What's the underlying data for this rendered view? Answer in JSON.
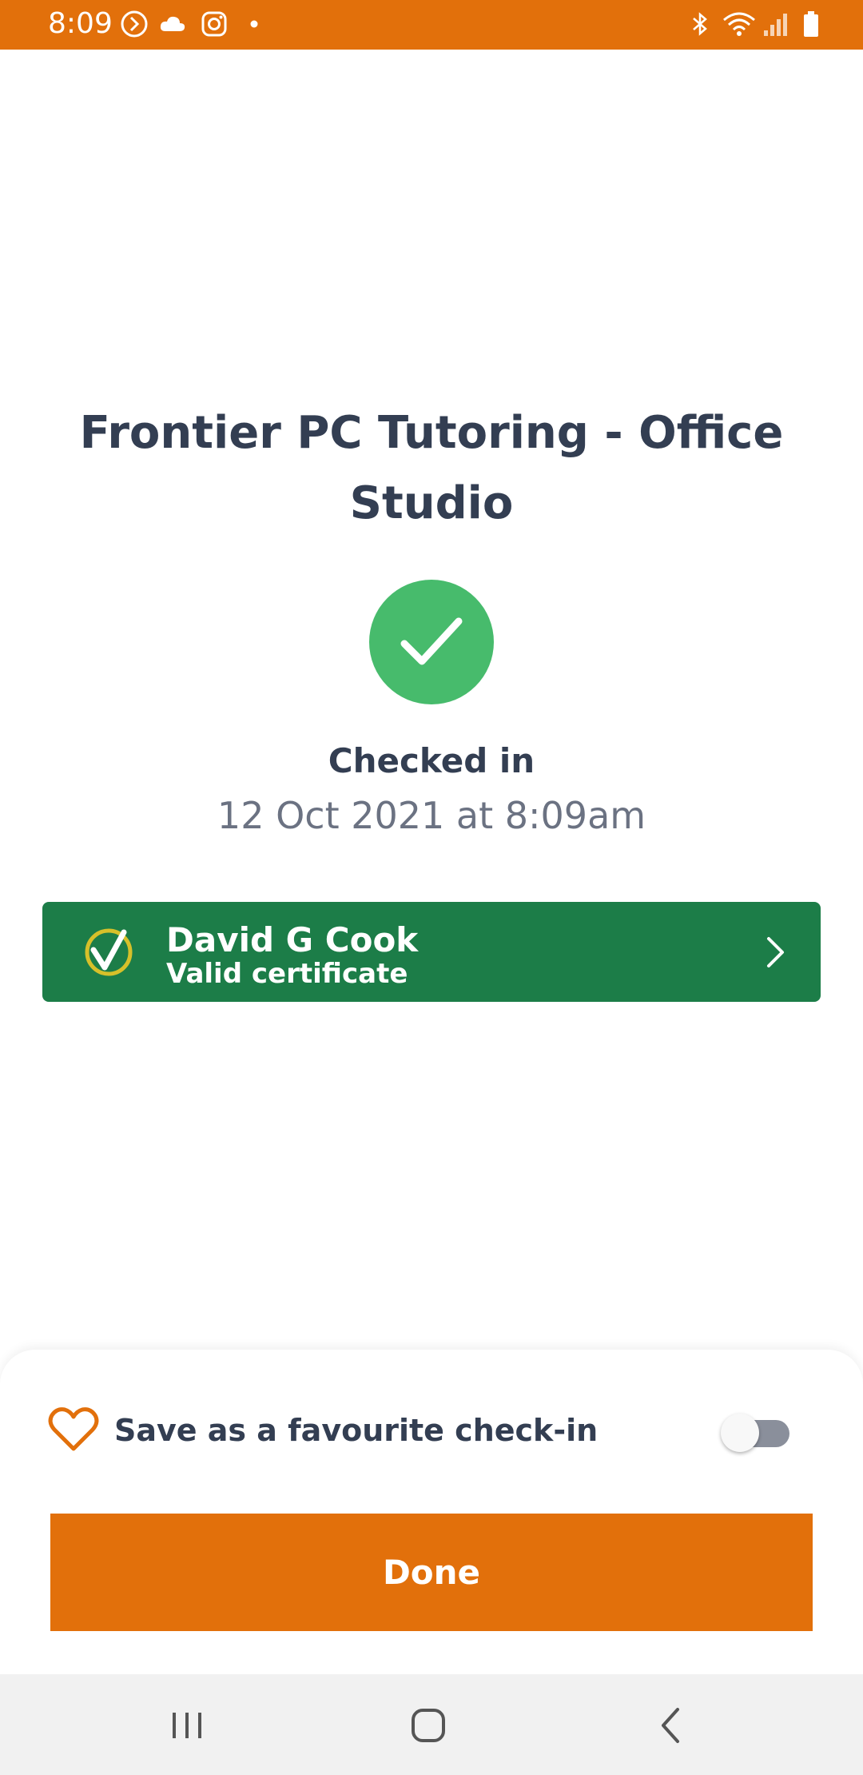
{
  "status_bar": {
    "time": "8:09",
    "icons": [
      "sync-icon",
      "cloud-icon",
      "instagram-icon",
      "notification-dot-icon",
      "bluetooth-icon",
      "wifi-icon",
      "signal-icon",
      "battery-icon"
    ]
  },
  "venue": {
    "title": "Frontier PC Tutoring - Office Studio"
  },
  "check_in": {
    "label": "Checked in",
    "timestamp": "12 Oct 2021 at 8:09am",
    "icon": "checkmark-icon"
  },
  "certificate": {
    "name": "David G Cook",
    "status": "Valid certificate",
    "icon": "certificate-check-icon"
  },
  "favourite": {
    "label": "Save as a favourite check-in",
    "enabled": false
  },
  "actions": {
    "done_label": "Done"
  },
  "colors": {
    "brand_orange": "#e2700b",
    "success_green": "#47bb6c",
    "certificate_green": "#1c7d48",
    "text_dark": "#333e52",
    "text_muted": "#6b7282"
  },
  "nav_bar": {
    "icons": [
      "recent-apps-icon",
      "home-icon",
      "back-icon"
    ]
  }
}
